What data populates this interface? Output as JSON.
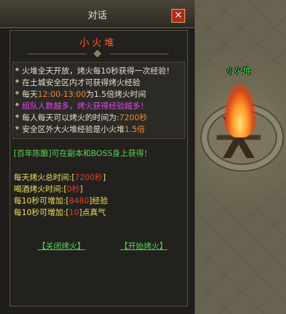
{
  "dialog": {
    "title": "对话",
    "close_icon": "×",
    "heading": "小火堆"
  },
  "info_lines": [
    {
      "text": "火堆全天开放，烤火每10秒获得一次经验！"
    },
    {
      "text": "在土城安全区内才可获得烤火经验"
    },
    {
      "prefix": "每天",
      "time": "12:00-13:00",
      "suffix": "为1.5倍烤火时间"
    },
    {
      "text": "组队人数越多，烤火获得经验越多！"
    },
    {
      "prefix": "每人每天可以烤火的时间为:",
      "value": "7200秒"
    },
    {
      "prefix": "安全区外大火堆经验是小火堆",
      "value": "1.5倍"
    }
  ],
  "source_note": "[百年陈酿]可在副本和BOSS身上获得！",
  "stats": [
    {
      "label": "每天烤火总时间:",
      "lb": "[",
      "value": "7200秒",
      "rb": "]",
      "unit": ""
    },
    {
      "label": "喝酒烤火时间:",
      "lb": "[",
      "value": "0秒",
      "rb": "]",
      "unit": ""
    },
    {
      "label": "每10秒可增加:",
      "lb": "[",
      "value": "8480",
      "rb": "]",
      "unit": "经验"
    },
    {
      "label": "每10秒可增加:",
      "lb": "[",
      "value": "10",
      "rb": "]",
      "unit": "点真气"
    }
  ],
  "buttons": {
    "stop": "【关闭烤火】",
    "start": "【开始烤火】"
  },
  "world": {
    "campfire_label": "小火堆"
  },
  "colors": {
    "accent_title": "#ff5a2a",
    "highlight": "#e14be6",
    "value": "#f08a3a",
    "link": "#5ad456"
  }
}
